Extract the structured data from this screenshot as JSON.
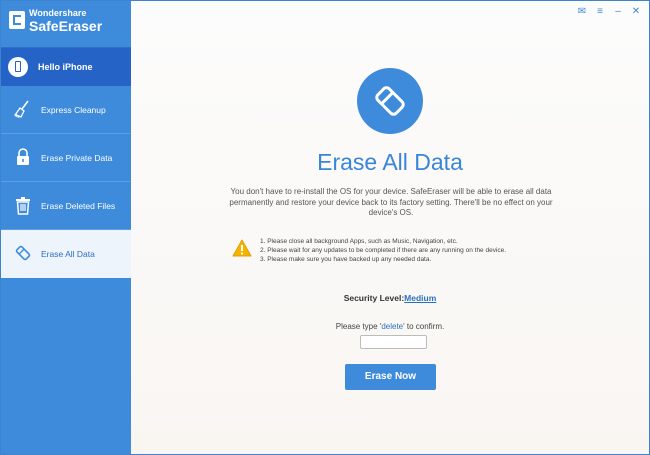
{
  "app": {
    "maker": "Wondershare",
    "name": "SafeEraser"
  },
  "window_controls": [
    {
      "name": "feedback-icon",
      "glyph": "✉"
    },
    {
      "name": "menu-icon",
      "glyph": "≡"
    },
    {
      "name": "minimize-icon",
      "glyph": "–"
    },
    {
      "name": "close-icon",
      "glyph": "✕"
    }
  ],
  "sidebar": {
    "device_label": "Hello iPhone",
    "items": [
      {
        "label": "Express Cleanup",
        "icon": "broom-icon",
        "active": false
      },
      {
        "label": "Erase Private Data",
        "icon": "lock-icon",
        "active": false
      },
      {
        "label": "Erase Deleted Files",
        "icon": "trash-icon",
        "active": false
      },
      {
        "label": "Erase All Data",
        "icon": "eraser-icon",
        "active": true
      }
    ]
  },
  "main": {
    "title": "Erase All Data",
    "description": "You don't have to re-install the OS for your device. SafeEraser will be able to erase all data permanently  and restore your device back to its factory setting. There'll be no effect on your device's OS.",
    "warnings": [
      "1. Please close all background Apps, such as Music, Navigation, etc.",
      "2. Please wait for any updates to be completed if there are any running on the device.",
      "3. Please make sure you have backed up any needed data."
    ],
    "security_label": "Security Level:",
    "security_level": "Medium",
    "confirm_prefix": "Please type '",
    "confirm_keyword": "delete",
    "confirm_suffix": "' to confirm.",
    "confirm_value": "",
    "erase_button": "Erase Now"
  },
  "colors": {
    "sidebar": "#3e8bdc",
    "sidebar_selected": "#2563c6",
    "accent": "#3a86d6",
    "warning": "#f5b400"
  }
}
